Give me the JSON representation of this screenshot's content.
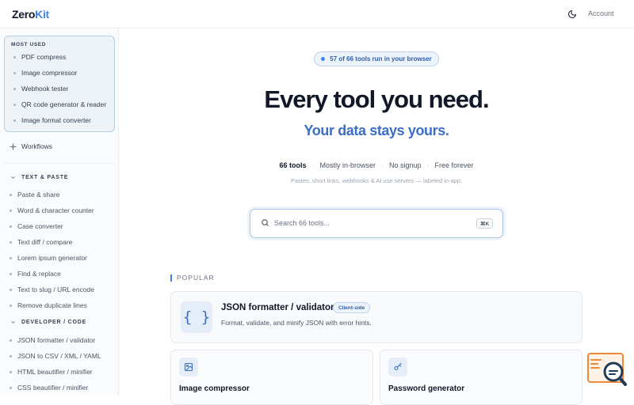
{
  "header": {
    "logo_prefix": "Zero",
    "logo_accent": "Kit",
    "account_label": "Account",
    "theme_icon": "moon-icon"
  },
  "sidebar": {
    "most_used_title": "MOST USED",
    "most_used": [
      "PDF compress",
      "Image compressor",
      "Webhook tester",
      "QR code generator & reader",
      "Image format converter"
    ],
    "workflows_label": "Workflows",
    "sections": [
      {
        "title": "TEXT & PASTE",
        "items": [
          "Paste & share",
          "Word & character counter",
          "Case converter",
          "Text diff / compare",
          "Lorem ipsum generator",
          "Find & replace",
          "Text to slug / URL encode",
          "Remove duplicate lines"
        ]
      },
      {
        "title": "DEVELOPER / CODE",
        "items": [
          "JSON formatter / validator",
          "JSON to CSV / XML / YAML",
          "HTML beautifier / minifier",
          "CSS beautifier / minifier"
        ]
      }
    ]
  },
  "main": {
    "pill_text": "57 of 66 tools run in your browser",
    "title": "Every tool you need.",
    "subtitle": "Your data stays yours.",
    "stats": {
      "tools": "66 tools",
      "browser": "Mostly in-browser",
      "signup": "No signup",
      "free": "Free forever",
      "sep": "·"
    },
    "fineprint": "Pastes, short links, webhooks & AI use servers — labeled in-app.",
    "search": {
      "placeholder": "Search 66 tools...",
      "shortcut": "⌘K"
    },
    "popular_label": "POPULAR",
    "featured": {
      "icon_text": "{ }",
      "title": "JSON formatter / validator",
      "badge": "Client-side",
      "description": "Format, validate, and minify JSON with error hints."
    },
    "cards": [
      {
        "title": "Image compressor",
        "icon": "image-icon"
      },
      {
        "title": "Password generator",
        "icon": "key-icon"
      }
    ]
  },
  "colors": {
    "accent": "#3b82f6",
    "accent_text": "#3b6fc6",
    "pill_bg": "#edf3fb"
  }
}
